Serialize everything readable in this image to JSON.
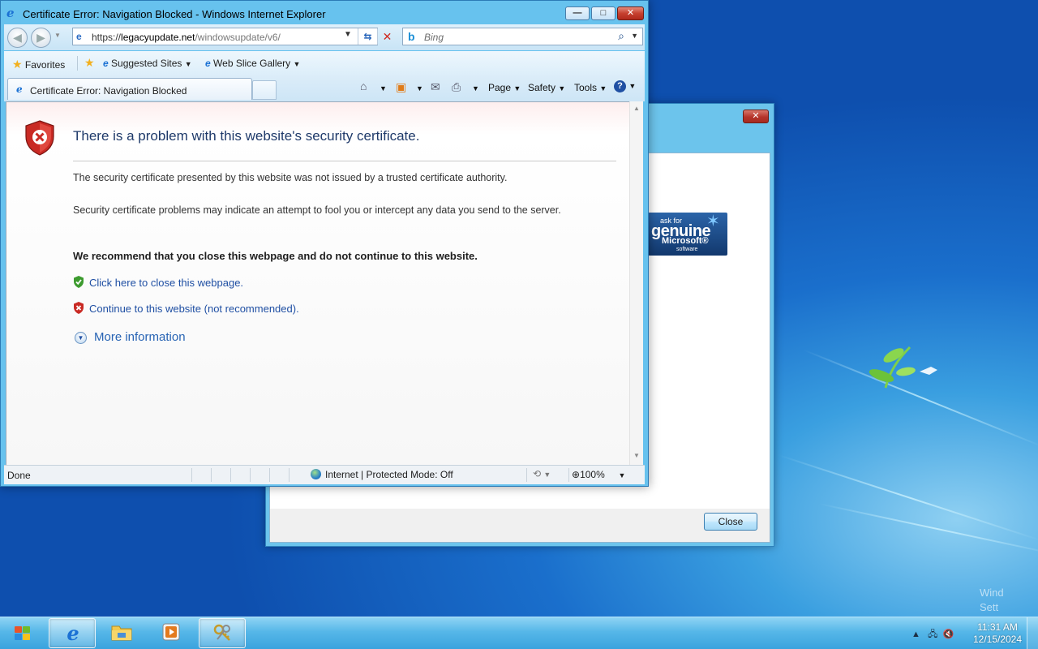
{
  "ie": {
    "title": "Certificate Error: Navigation Blocked - Windows Internet Explorer",
    "window_buttons": {
      "minimize": "—",
      "maximize": "□",
      "close": "✕"
    },
    "address": {
      "scheme": "https://",
      "domain": "legacyupdate.net",
      "path": "/windowsupdate/v6/"
    },
    "search": {
      "placeholder": "Bing"
    },
    "favorites": {
      "favorites_label": "Favorites",
      "suggested_sites": "Suggested Sites",
      "web_slice_gallery": "Web Slice Gallery"
    },
    "tab": {
      "title": "Certificate Error: Navigation Blocked"
    },
    "commands": {
      "page": "Page",
      "safety": "Safety",
      "tools": "Tools"
    },
    "content": {
      "heading": "There is a problem with this website's security certificate.",
      "p1": "The security certificate presented by this website was not issued by a trusted certificate authority.",
      "p2": "Security certificate problems may indicate an attempt to fool you or intercept any data you send to the server.",
      "recommend": "We recommend that you close this webpage and do not continue to this website.",
      "close_link": "Click here to close this webpage.",
      "continue_link": "Continue to this website (not recommended).",
      "more_info": "More information"
    },
    "status": {
      "done": "Done",
      "zone": "Internet | Protected Mode: Off",
      "zoom": "100%"
    }
  },
  "dialog": {
    "close_x": "✕",
    "close_button": "Close",
    "genuine": {
      "line1": "ask for",
      "line2": "genuine",
      "line3": "Microsoft®",
      "line4": "software"
    }
  },
  "taskbar": {
    "clock_time": "11:31 AM",
    "clock_date": "12/15/2024"
  },
  "watermark": {
    "line1": "Wind",
    "line2": "Sett"
  },
  "colors": {
    "accent": "#1f4fa3",
    "heading": "#1f3a6a",
    "danger": "#c6402f"
  }
}
